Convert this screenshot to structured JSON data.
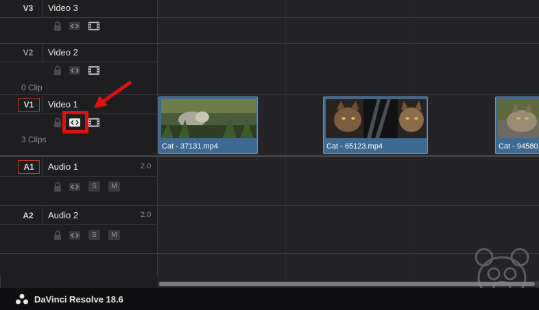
{
  "app_title": "DaVinci Resolve 18.6",
  "tracks": {
    "video3": {
      "tag": "V3",
      "name": "Video 3",
      "count": ""
    },
    "video2": {
      "tag": "V2",
      "name": "Video 2",
      "count": "0 Clip"
    },
    "video1": {
      "tag": "V1",
      "name": "Video 1",
      "count": "3 Clips"
    },
    "audio1": {
      "tag": "A1",
      "name": "Audio 1",
      "level": "2.0",
      "solo": "S",
      "mute": "M"
    },
    "audio2": {
      "tag": "A2",
      "name": "Audio 2",
      "level": "2.0",
      "solo": "S",
      "mute": "M"
    }
  },
  "clips": [
    {
      "label": "Cat - 37131.mp4"
    },
    {
      "label": "Cat - 65123.mp4"
    },
    {
      "label": "Cat - 94580."
    }
  ],
  "icons": {
    "lock": "lock-icon",
    "auto_select": "auto-select-icon",
    "enable_track": "film-strip-icon"
  },
  "colors": {
    "clip": "#3e6a92",
    "highlight": "#e0100f",
    "track_tag_border": "#c0392b"
  }
}
